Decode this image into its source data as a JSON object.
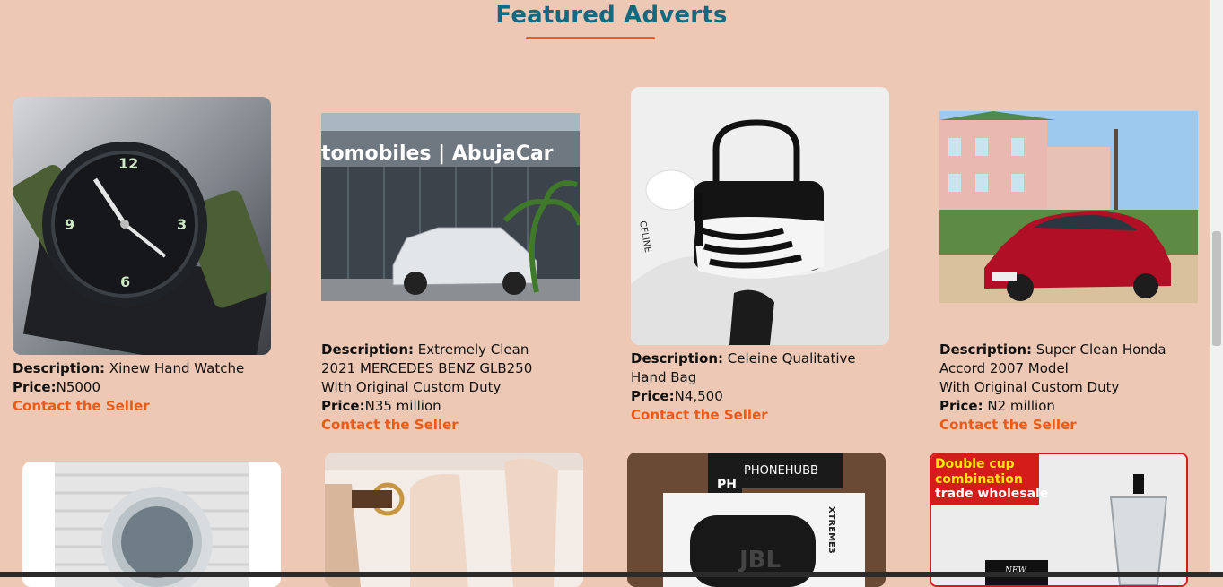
{
  "section": {
    "title": "Featured Adverts"
  },
  "adverts": [
    {
      "description_label": "Description:",
      "description": "Xinew Hand Watche",
      "price_label": "Price:",
      "price": "N5000",
      "contact": "Contact the Seller"
    },
    {
      "description_label": "Description:",
      "description": "Extremely Clean 2021 MERCEDES BENZ GLB250 With Original Custom Duty",
      "price_label": "Price:",
      "price": "N35 million",
      "contact": "Contact the Seller",
      "image_text": "tomobiles | AbujaCar"
    },
    {
      "description_label": "Description:",
      "description": "Celeine Qualitative Hand Bag",
      "price_label": "Price:",
      "price": "N4,500",
      "contact": "Contact the Seller",
      "image_text": "CELINE"
    },
    {
      "description_label": "Description:",
      "description": "Super Clean Honda Accord 2007 Model",
      "description_line2": "With Original Custom Duty",
      "price_label": "Price:",
      "price": " N2 million",
      "contact": "Contact the Seller"
    }
  ],
  "second_row": [
    {
      "name": "mirror"
    },
    {
      "name": "handbag-strap"
    },
    {
      "name": "jbl-speaker",
      "image_text": "PHONEHUBB",
      "badge": "PH",
      "box_text": "XTREME3"
    },
    {
      "name": "blender",
      "banner_line1": "Double cup",
      "banner_line2": "combination",
      "banner_line3": "trade wholesale",
      "box_text": "NEW"
    }
  ]
}
